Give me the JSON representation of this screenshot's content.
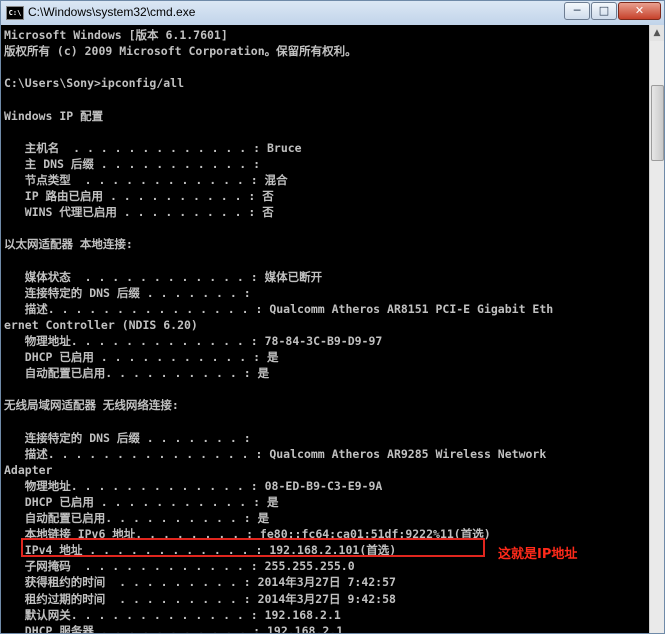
{
  "window": {
    "title": "C:\\Windows\\system32\\cmd.exe",
    "icon_label": "C:\\",
    "minimize_glyph": "─",
    "maximize_glyph": "□",
    "close_glyph": "✕"
  },
  "console": {
    "lines": [
      "Microsoft Windows [版本 6.1.7601]",
      "版权所有 (c) 2009 Microsoft Corporation。保留所有权利。",
      "",
      "C:\\Users\\Sony>ipconfig/all",
      "",
      "Windows IP 配置",
      "",
      "   主机名  . . . . . . . . . . . . . : Bruce",
      "   主 DNS 后缀 . . . . . . . . . . . :",
      "   节点类型  . . . . . . . . . . . . : 混合",
      "   IP 路由已启用 . . . . . . . . . . : 否",
      "   WINS 代理已启用 . . . . . . . . . : 否",
      "",
      "以太网适配器 本地连接:",
      "",
      "   媒体状态  . . . . . . . . . . . . : 媒体已断开",
      "   连接特定的 DNS 后缀 . . . . . . . :",
      "   描述. . . . . . . . . . . . . . . : Qualcomm Atheros AR8151 PCI-E Gigabit Eth",
      "ernet Controller (NDIS 6.20)",
      "   物理地址. . . . . . . . . . . . . : 78-84-3C-B9-D9-97",
      "   DHCP 已启用 . . . . . . . . . . . : 是",
      "   自动配置已启用. . . . . . . . . . : 是",
      "",
      "无线局域网适配器 无线网络连接:",
      "",
      "   连接特定的 DNS 后缀 . . . . . . . :",
      "   描述. . . . . . . . . . . . . . . : Qualcomm Atheros AR9285 Wireless Network",
      "Adapter",
      "   物理地址. . . . . . . . . . . . . : 08-ED-B9-C3-E9-9A",
      "   DHCP 已启用 . . . . . . . . . . . : 是",
      "   自动配置已启用. . . . . . . . . . : 是",
      "   本地链接 IPv6 地址. . . . . . . . : fe80::fc64:ca01:51df:9222%11(首选)",
      "   IPv4 地址 . . . . . . . . . . . . : 192.168.2.101(首选)",
      "   子网掩码  . . . . . . . . . . . . : 255.255.255.0",
      "   获得租约的时间  . . . . . . . . . : 2014年3月27日 7:42:57",
      "   租约过期的时间  . . . . . . . . . : 2014年3月27日 9:42:58",
      "   默认网关. . . . . . . . . . . . . : 192.168.2.1",
      "   DHCP 服务器 . . . . . . . . . . . : 192.168.2.1"
    ]
  },
  "annotation": {
    "text": "这就是IP地址",
    "color": "#ff2a1a"
  },
  "colors": {
    "console_bg": "#000000",
    "console_text": "#c0c0c0",
    "highlight": "#e0261e"
  }
}
